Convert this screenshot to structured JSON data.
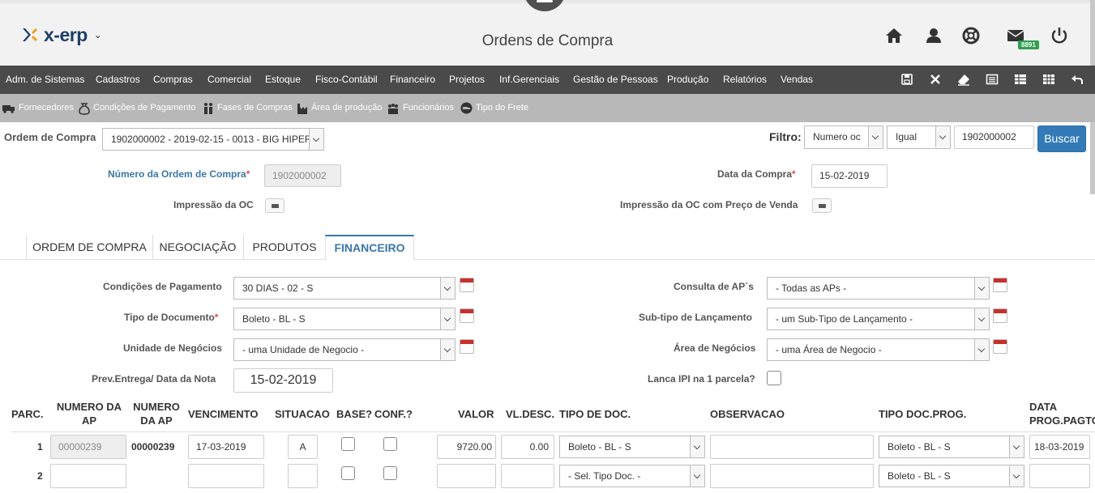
{
  "app": {
    "logo_text": "x-erp",
    "page_title": "Ordens de Compra",
    "notification_count": "8891"
  },
  "menu": [
    "Adm. de Sistemas",
    "Cadastros",
    "Compras",
    "Comercial",
    "Estoque",
    "Fisco-Contábil",
    "Financeiro",
    "Projetos",
    "Inf.Gerenciais",
    "Gestão de Pessoas",
    "Produção",
    "Relatórios",
    "Vendas"
  ],
  "shortcuts": [
    "Fornecedores",
    "Condições de Pagamento",
    "Fases de Compras",
    "Área de produção",
    "Funcionários",
    "Tipo do Frete"
  ],
  "form": {
    "ordem_label": "Ordem de Compra",
    "ordem_value": "1902000002 - 2019-02-15 - 0013 - BIG HIPER",
    "filtro_label": "Filtro:",
    "filtro_field": "Numero oc",
    "filtro_op": "Igual",
    "filtro_value": "1902000002",
    "buscar_label": "Buscar",
    "numero_label": "Número da Ordem de Compra",
    "numero_value": "1902000002",
    "data_label": "Data da Compra",
    "data_value": "15-02-2019",
    "impressao_label": "Impressão da OC",
    "impressao_preco_label": "Impressão da OC com Preço de Venda",
    "required_mark": "*"
  },
  "tabs": [
    "ORDEM DE COMPRA",
    "NEGOCIAÇÃO",
    "PRODUTOS",
    "FINANCEIRO"
  ],
  "financeiro": {
    "cond_label": "Condições de Pagamento",
    "cond_value": "30 DIAS - 02 - S",
    "tipo_label": "Tipo de Documento",
    "tipo_value": "Boleto - BL - S",
    "unidade_label": "Unidade de Negócios",
    "unidade_value": "- uma Unidade de Negocio -",
    "prev_label": "Prev.Entrega/ Data da Nota",
    "prev_value": "15-02-2019",
    "consulta_label": "Consulta de AP´s",
    "consulta_value": "- Todas as APs -",
    "subtipo_label": "Sub-tipo de Lançamento",
    "subtipo_value": "- um Sub-Tipo de Lançamento -",
    "area_label": "Área de Negócios",
    "area_value": "- uma Área de Negocio -",
    "ipi_label": "Lanca IPI na 1 parcela?"
  },
  "table": {
    "headers": {
      "parc": "PARC.",
      "numero_ap_1": "NUMERO DA",
      "numero_ap_2": "AP",
      "numero_ap_b1": "NUMERO",
      "numero_ap_b2": "DA AP",
      "vencimento": "VENCIMENTO",
      "situacao": "SITUACAO",
      "base": "BASE?",
      "conf": "CONF.?",
      "valor": "VALOR",
      "vldesc": "VL.DESC.",
      "tipo_doc": "TIPO DE DOC.",
      "observacao": "OBSERVACAO",
      "tipo_doc_prog": "TIPO DOC.PROG.",
      "data_1": "DATA",
      "data_2": "PROG.PAGTO"
    },
    "rows": [
      {
        "parc": "1",
        "numero_ap_input": "00000239",
        "numero_ap": "00000239",
        "vencimento": "17-03-2019",
        "situacao": "A",
        "valor": "9720.00",
        "vldesc": "0.00",
        "tipo_doc": "Boleto - BL - S",
        "observacao": "",
        "tipo_doc_prog": "Boleto - BL - S",
        "data_prog": "18-03-2019"
      },
      {
        "parc": "2",
        "numero_ap_input": "",
        "numero_ap": "",
        "vencimento": "",
        "situacao": "",
        "valor": "",
        "vldesc": "",
        "tipo_doc": "- Sel. Tipo Doc. -",
        "observacao": "",
        "tipo_doc_prog": "Boleto - BL - S",
        "data_prog": ""
      }
    ]
  }
}
